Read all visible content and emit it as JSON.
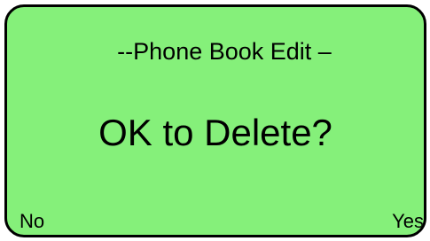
{
  "screen": {
    "title": "--Phone Book Edit –",
    "prompt": "OK to Delete?",
    "softkeys": {
      "left_label": "No",
      "right_label": "Yes"
    },
    "colors": {
      "display_background": "#85f07a",
      "text": "#000000",
      "border": "#000000"
    }
  }
}
